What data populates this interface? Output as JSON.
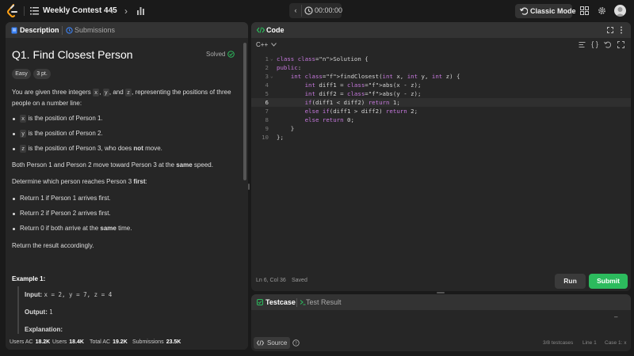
{
  "topbar": {
    "contest_title": "Weekly Contest 445",
    "prev_icon": "chevron-left-icon",
    "next_icon": "chevron-right-icon",
    "timer": "00:00:00",
    "mode_button": "Classic Mode"
  },
  "left_panel": {
    "tabs": {
      "description": "Description",
      "submissions": "Submissions"
    },
    "title": "Q1. Find Closest Person",
    "solved": "Solved",
    "difficulty": "Easy",
    "points": "3 pt.",
    "intro": {
      "p1": "You are given three integers ",
      "x": "x",
      "c1": ", ",
      "y": "y",
      "c2": ", and ",
      "z": "z",
      "p2": ", representing the positions of three",
      "line2": "people on a number line:"
    },
    "bullets1": [
      {
        "code": "x",
        "text": " is the position of Person 1."
      },
      {
        "code": "y",
        "text": " is the position of Person 2."
      },
      {
        "code": "z",
        "text_a": " is the position of Person 3, who does ",
        "bold": "not",
        "text_b": " move."
      }
    ],
    "move_a": "Both Person 1 and Person 2 move toward Person 3 at the ",
    "move_b": "same",
    "move_c": " speed.",
    "determine_a": "Determine which person reaches Person 3 ",
    "determine_b": "first",
    "determine_c": ":",
    "bullets2": [
      {
        "text": "Return 1 if Person 1 arrives first."
      },
      {
        "text": "Return 2 if Person 2 arrives first."
      },
      {
        "text_a": "Return 0 if both arrive at the ",
        "bold": "same",
        "text_b": " time."
      }
    ],
    "return_text": "Return the result accordingly.",
    "example_heading": "Example 1:",
    "example": {
      "input_label": "Input:",
      "input_value": "x = 2, y = 7, z = 4",
      "output_label": "Output:",
      "output_value": "1",
      "explanation_label": "Explanation:"
    },
    "status_bar": {
      "users_ac_label": "Users AC",
      "users_ac": "18.2K",
      "users_label": "Users",
      "users": "18.4K",
      "total_ac_label": "Total AC",
      "total_ac": "19.2K",
      "submissions_label": "Submissions",
      "submissions": "23.5K"
    }
  },
  "code_panel": {
    "tab": "Code",
    "language": "C++",
    "cursor": "Ln 6, Col 36",
    "saved": "Saved",
    "run": "Run",
    "submit": "Submit",
    "current_line": 6,
    "lines": [
      "class Solution {",
      "public:",
      "    int findClosest(int x, int y, int z) {",
      "        int diff1 = abs(x - z);",
      "        int diff2 = abs(y - z);",
      "        if(diff1 < diff2) return 1;",
      "        else if(diff1 > diff2) return 2;",
      "        else return 0;",
      "    }",
      "};"
    ]
  },
  "test_panel": {
    "testcase_tab": "Testcase",
    "result_tab": "Test Result",
    "dash": "–",
    "source": "Source",
    "testcases": "3/8 testcases",
    "line": "Line 1",
    "case": "Case 1: x"
  }
}
